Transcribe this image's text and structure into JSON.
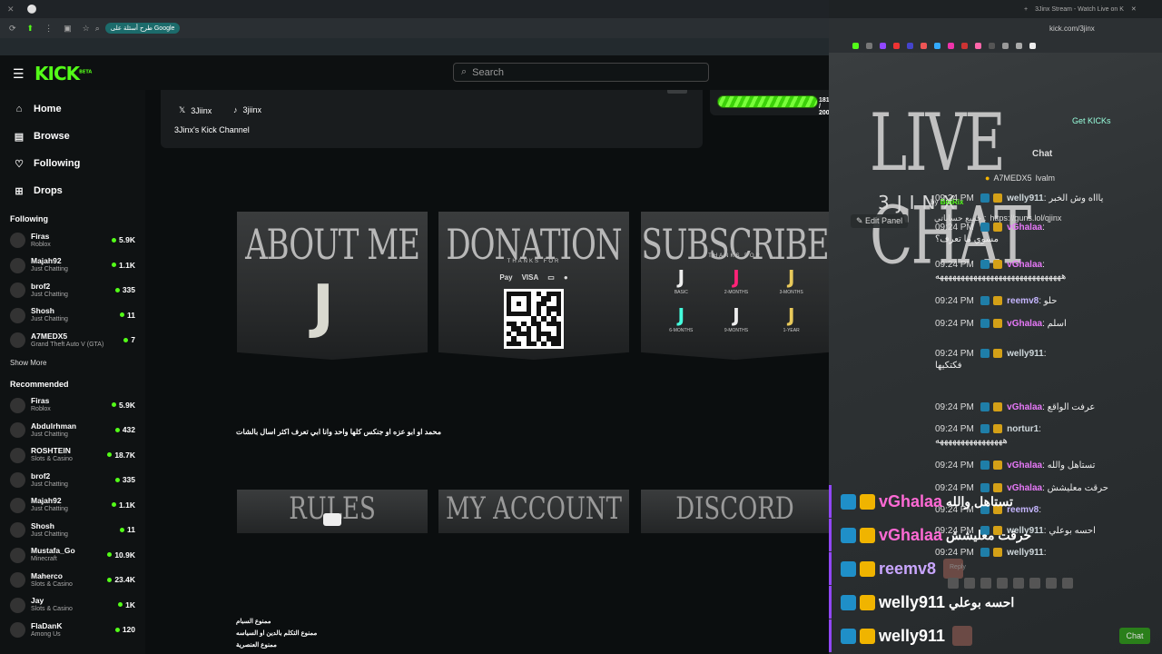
{
  "browser": {
    "google_chip": "طرح أسئلة على Google",
    "right_tab_title": "3Jinx Stream - Watch Live on K",
    "right_url": "kick.com/3jinx"
  },
  "nav": {
    "search_placeholder": "Search",
    "logo": "KICK",
    "logo_tag": "BETA"
  },
  "sidebar": {
    "items": [
      {
        "label": "Home",
        "icon": "home-icon"
      },
      {
        "label": "Browse",
        "icon": "browse-icon"
      },
      {
        "label": "Following",
        "icon": "heart-icon"
      },
      {
        "label": "Drops",
        "icon": "gift-icon"
      }
    ],
    "following_title": "Following",
    "following": [
      {
        "name": "Firas",
        "cat": "Roblox",
        "viewers": "5.9K"
      },
      {
        "name": "Majah92",
        "cat": "Just Chatting",
        "viewers": "1.1K"
      },
      {
        "name": "brof2",
        "cat": "Just Chatting",
        "viewers": "335"
      },
      {
        "name": "Shosh",
        "cat": "Just Chatting",
        "viewers": "11"
      },
      {
        "name": "A7MEDX5",
        "cat": "Grand Theft Auto V (GTA)",
        "viewers": "7"
      }
    ],
    "show_more": "Show More",
    "recommended_title": "Recommended",
    "recommended": [
      {
        "name": "Firas",
        "cat": "Roblox",
        "viewers": "5.9K"
      },
      {
        "name": "Abdulrhman",
        "cat": "Just Chatting",
        "viewers": "432"
      },
      {
        "name": "ROSHTEIN",
        "cat": "Slots & Casino",
        "viewers": "18.7K"
      },
      {
        "name": "brof2",
        "cat": "Just Chatting",
        "viewers": "335"
      },
      {
        "name": "Majah92",
        "cat": "Just Chatting",
        "viewers": "1.1K"
      },
      {
        "name": "Shosh",
        "cat": "Just Chatting",
        "viewers": "11"
      },
      {
        "name": "Mustafa_Go",
        "cat": "Minecraft",
        "viewers": "10.9K"
      },
      {
        "name": "Maherco",
        "cat": "Slots & Casino",
        "viewers": "23.4K"
      },
      {
        "name": "Jay",
        "cat": "Slots & Casino",
        "viewers": "1K"
      },
      {
        "name": "FlaDanK",
        "cat": "Among Us",
        "viewers": "120"
      }
    ]
  },
  "about": {
    "x_handle": "3Jiinx",
    "tiktok_handle": "3jiinx",
    "channel_desc": "3Jinx's Kick Channel",
    "goal_count": "181 / 200",
    "goal_progress": 0.905
  },
  "panels": {
    "about_title": "ABOUT ME",
    "donation_title": "DONATION",
    "donation_sub": "THANKS FOR",
    "pay_methods": [
      "Pay",
      "VISA"
    ],
    "subscribe_title": "SUBSCRIBE",
    "subscribe_sub": "THANKS FOR",
    "tiers": [
      "BASIC",
      "2-MONTHS",
      "3-MONTHS",
      "6-MONTHS",
      "9-MONTHS",
      "1-YEAR"
    ],
    "about_desc": "محمد او ابو عزه او جنكس كلها واحد وانا ابي تعرف اكثر اسال بالشات",
    "rules_title": "RULES",
    "account_title": "MY ACCOUNT",
    "discord_title": "DISCORD",
    "rules_lines": [
      "ممنوع السبام",
      "ممنوع التكلم بالدين او السياسه",
      "ممنوع العنصرية"
    ]
  },
  "chat": {
    "overlay_title": "LIVE CHAT",
    "overlay_sub": "3JINX",
    "header": "Chat",
    "get_kicks": "Get KICKs",
    "top_gifter": "A7MEDX5",
    "top_gifter2": "Ivalm",
    "edit_panel": "Edit Panel",
    "pinned_by_label": "by",
    "pinned_bot": "BotRix",
    "pinned_link": "https://guns.lol/qjinx",
    "pinned_prefix": "جميع حساباتي :",
    "reply_label": "Reply",
    "send": "Chat",
    "messages": [
      {
        "time": "09:24 PM",
        "user": "welly911",
        "color": "#cfd8dc",
        "text": "ياااه وش الخبر"
      },
      {
        "time": "09:24 PM",
        "user": "vGhalaa",
        "color": "#e879f9",
        "text": "مسوي ما تعرف؟"
      },
      {
        "time": "09:24 PM",
        "user": "vGhalaa",
        "color": "#e879f9",
        "text": "ههههههههههههههههههههههههههههههه"
      },
      {
        "time": "09:24 PM",
        "user": "reemv8",
        "color": "#c4b5fd",
        "text": "حلو"
      },
      {
        "time": "09:24 PM",
        "user": "vGhalaa",
        "color": "#e879f9",
        "text": "اسلم"
      },
      {
        "time": "09:24 PM",
        "user": "welly911",
        "color": "#cfd8dc",
        "text": "فكتكيها"
      },
      {
        "time": "09:24 PM",
        "user": "vGhalaa",
        "color": "#e879f9",
        "text": "عرفت الواقع"
      },
      {
        "time": "09:24 PM",
        "user": "nortur1",
        "color": "#cfd8dc",
        "text": "ههههههههههههههههه"
      },
      {
        "time": "09:24 PM",
        "user": "vGhalaa",
        "color": "#e879f9",
        "text": "تستاهل والله"
      },
      {
        "time": "09:24 PM",
        "user": "vGhalaa",
        "color": "#e879f9",
        "text": "حرقت معليشش"
      },
      {
        "time": "09:24 PM",
        "user": "reemv8",
        "color": "#c4b5fd",
        "text": ""
      },
      {
        "time": "09:24 PM",
        "user": "welly911",
        "color": "#cfd8dc",
        "text": "احسه بوعلي"
      },
      {
        "time": "09:24 PM",
        "user": "welly911",
        "color": "#cfd8dc",
        "text": ""
      }
    ],
    "overlay_messages": [
      {
        "user": "vGhalaa",
        "color": "#ff6ad5",
        "text": "تستاهل والله"
      },
      {
        "user": "vGhalaa",
        "color": "#ff6ad5",
        "text": "حرقت معليشش"
      },
      {
        "user": "reemv8",
        "color": "#c9a6ff",
        "text": ""
      },
      {
        "user": "welly911",
        "color": "#ffffff",
        "text": "احسه بوعلي"
      },
      {
        "user": "welly911",
        "color": "#ffffff",
        "text": ""
      }
    ]
  },
  "colors": {
    "brand": "#53fc18",
    "overlay_border": "#9147ff"
  }
}
